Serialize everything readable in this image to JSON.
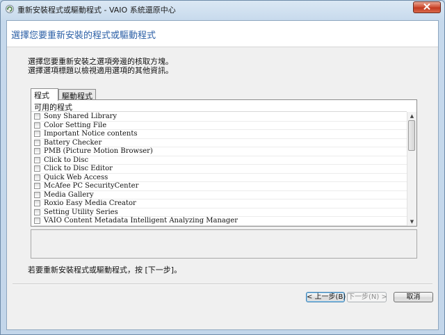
{
  "window": {
    "title": "重新安裝程式或驅動程式 - VAIO 系統還原中心"
  },
  "banner": {
    "title": "選擇您要重新安裝的程式或驅動程式"
  },
  "instructions": {
    "line1": "選擇您要重新安裝之選項旁邊的核取方塊。",
    "line2": "選擇選項標題以檢視適用選項的其他資訊。"
  },
  "tabs": [
    {
      "label": "程式",
      "active": true
    },
    {
      "label": "驅動程式",
      "active": false
    }
  ],
  "list": {
    "header": "可用的程式",
    "items": [
      "Sony Shared Library",
      "Color Setting File",
      "Important Notice contents",
      "Battery Checker",
      "PMB (Picture Motion Browser)",
      "Click to Disc",
      "Click to Disc Editor",
      "Quick Web Access",
      "McAfee PC SecurityCenter",
      "Media Gallery",
      "Roxio Easy Media Creator",
      "Setting Utility Series",
      "VAIO Content Metadata Intelligent Analyzing Manager"
    ]
  },
  "footer": {
    "note": "若要重新安裝程式或驅動程式，按 [下一步]。"
  },
  "buttons": {
    "back": "< 上一步(B)",
    "next": "下一步(N) >",
    "cancel": "取消"
  }
}
